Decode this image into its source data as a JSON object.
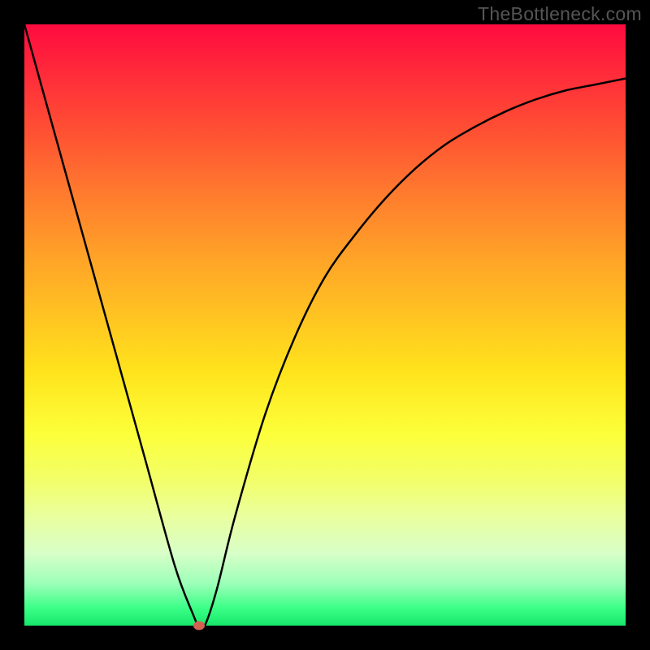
{
  "watermark": "TheBottleneck.com",
  "chart_data": {
    "type": "line",
    "title": "",
    "xlabel": "",
    "ylabel": "",
    "xlim": [
      0,
      100
    ],
    "ylim": [
      0,
      100
    ],
    "series": [
      {
        "name": "bottleneck-curve",
        "x": [
          0,
          5,
          10,
          15,
          20,
          25,
          28,
          29,
          30,
          32,
          35,
          40,
          45,
          50,
          55,
          60,
          65,
          70,
          75,
          80,
          85,
          90,
          95,
          100
        ],
        "values": [
          100,
          82,
          64,
          46,
          28,
          10,
          2,
          0,
          0,
          6,
          18,
          35,
          48,
          58,
          65,
          71,
          76,
          80,
          83,
          85.5,
          87.5,
          89,
          90,
          91
        ]
      }
    ],
    "marker": {
      "x": 29,
      "y": 0,
      "color": "#d26152"
    },
    "gradient_stops": [
      {
        "pos": 0,
        "color": "#ff0b3f"
      },
      {
        "pos": 50,
        "color": "#ffe41c"
      },
      {
        "pos": 100,
        "color": "#16e86a"
      }
    ]
  }
}
